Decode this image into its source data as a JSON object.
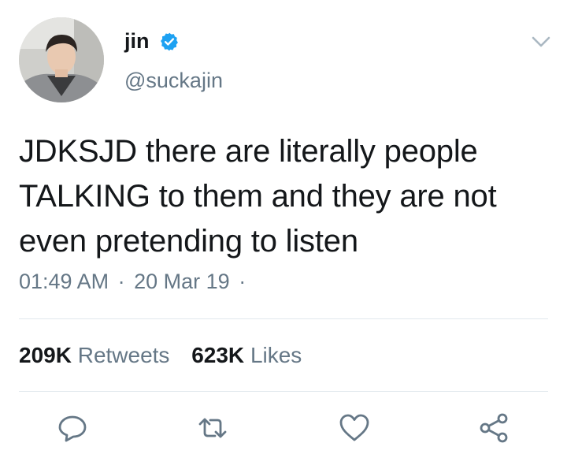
{
  "user": {
    "display_name": "jin",
    "handle": "@suckajin",
    "verified": true,
    "avatar_icon": "profile-photo"
  },
  "tweet": {
    "text": "JDKSJD there are literally people TALKING to them and they are not even pretending to listen",
    "time": "01:49 AM",
    "separator": "·",
    "date": "20 Mar 19",
    "trailing_separator": "·"
  },
  "stats": {
    "retweets_count": "209K",
    "retweets_label": "Retweets",
    "likes_count": "623K",
    "likes_label": "Likes"
  },
  "actions": [
    {
      "name": "reply",
      "icon": "reply-icon"
    },
    {
      "name": "retweet",
      "icon": "retweet-icon"
    },
    {
      "name": "like",
      "icon": "heart-icon"
    },
    {
      "name": "share",
      "icon": "share-icon"
    }
  ],
  "colors": {
    "text": "#14171a",
    "secondary": "#657786",
    "verified": "#1da1f2",
    "divider": "#e1e8ed"
  }
}
